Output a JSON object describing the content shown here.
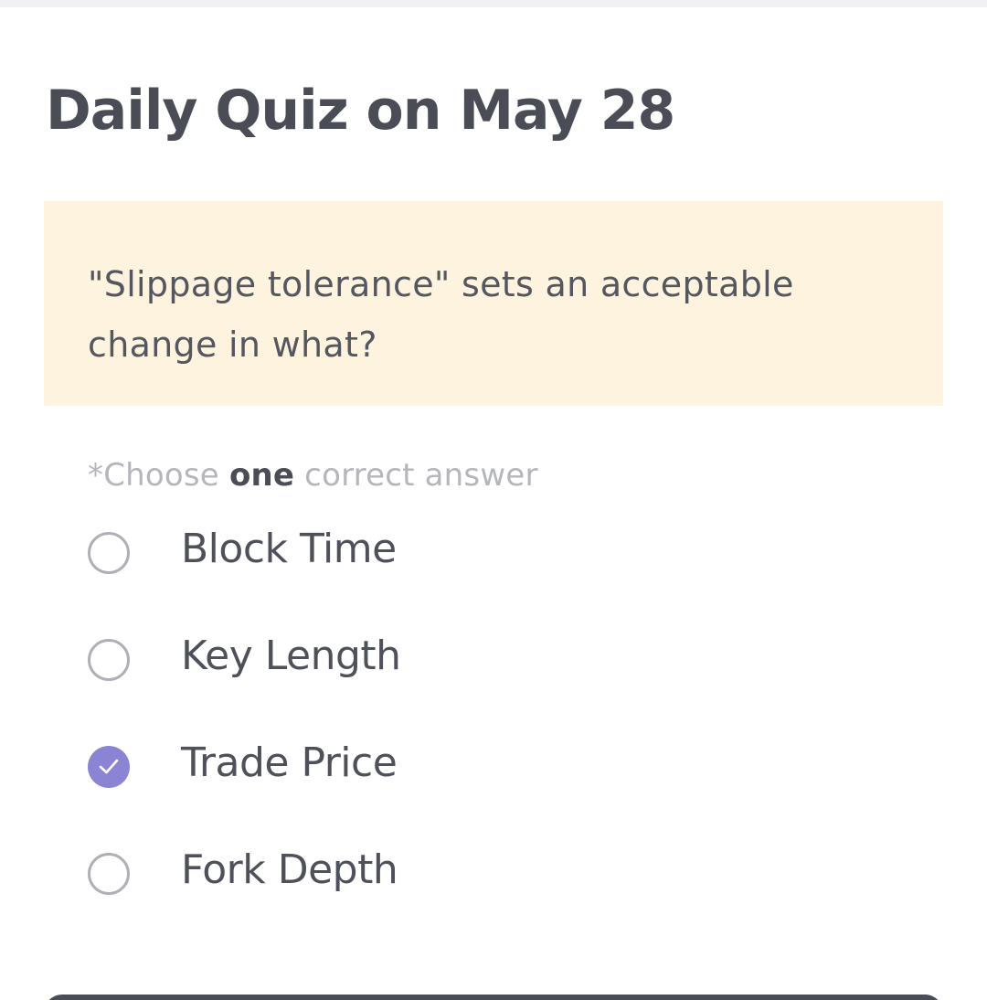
{
  "header": {
    "title": "Daily Quiz on May 28"
  },
  "question": {
    "text": "\"Slippage tolerance\" sets an acceptable change in what?"
  },
  "instruction": {
    "prefix": "*Choose ",
    "emphasis": "one",
    "suffix": " correct answer"
  },
  "options": [
    {
      "label": "Block Time",
      "selected": false
    },
    {
      "label": "Key Length",
      "selected": false
    },
    {
      "label": "Trade Price",
      "selected": true
    },
    {
      "label": "Fork Depth",
      "selected": false
    }
  ],
  "colors": {
    "accent": "#8b84d4",
    "question_bg": "#fdf3de",
    "text": "#4a4d55",
    "muted": "#b4b6bb"
  },
  "icons": {
    "selected": "check-icon"
  }
}
